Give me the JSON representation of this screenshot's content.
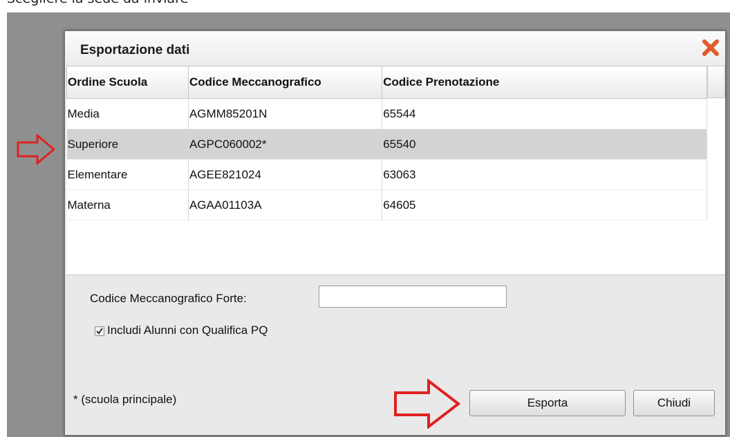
{
  "page": {
    "caption": "Scegliere la sede da inviare"
  },
  "dialog": {
    "title": "Esportazione dati",
    "close_icon": "close-icon"
  },
  "table": {
    "headers": [
      "Ordine Scuola",
      "Codice Meccanografico",
      "Codice Prenotazione"
    ],
    "rows": [
      [
        "Media",
        "AGMM85201N",
        "65544"
      ],
      [
        "Superiore",
        "AGPC060002*",
        "65540"
      ],
      [
        "Elementare",
        "AGEE821024",
        "63063"
      ],
      [
        "Materna",
        "AGAA01103A",
        "64605"
      ]
    ],
    "selected_row": 1
  },
  "form": {
    "label": "Codice Meccanografico Forte:",
    "value": "",
    "checkbox_label": "Includi Alunni con Qualifica PQ",
    "checkbox_checked": true
  },
  "footer": {
    "note": "* (scuola principale)",
    "export_label": "Esporta",
    "close_label": "Chiudi"
  },
  "colors": {
    "annotation_arrow": "#e02020",
    "close_icon": "#e05a2a",
    "selected_row": "#d3d3d3"
  }
}
